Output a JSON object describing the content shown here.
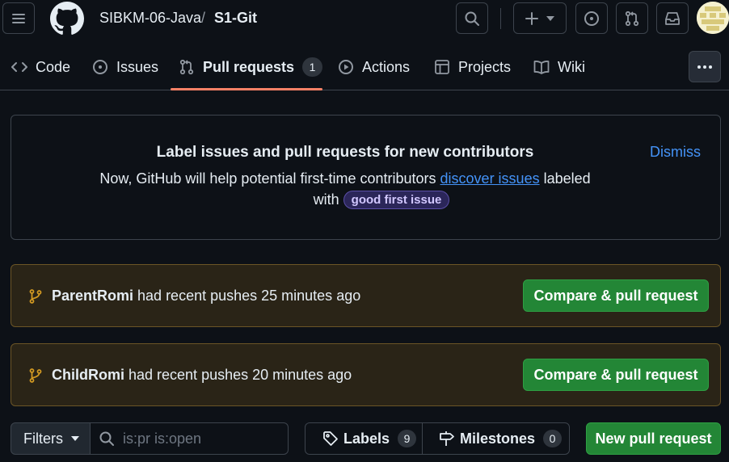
{
  "header": {
    "owner": "SIBKM-06-Java",
    "separator": "/",
    "repo": "S1-Git"
  },
  "nav": {
    "tabs": [
      {
        "label": "Code",
        "icon": "code-icon"
      },
      {
        "label": "Issues",
        "icon": "issue-opened-icon"
      },
      {
        "label": "Pull requests",
        "icon": "git-pull-request-icon",
        "count": "1",
        "active": true
      },
      {
        "label": "Actions",
        "icon": "play-icon"
      },
      {
        "label": "Projects",
        "icon": "table-icon"
      },
      {
        "label": "Wiki",
        "icon": "book-icon"
      }
    ]
  },
  "banner": {
    "title": "Label issues and pull requests for new contributors",
    "text_before_link": "Now, GitHub will help potential first-time contributors ",
    "link": "discover issues",
    "text_after_link": " labeled",
    "line2_prefix": "with ",
    "label": "good first issue",
    "dismiss": "Dismiss"
  },
  "pushes": [
    {
      "branch": "ParentRomi",
      "text": " had recent pushes 25 minutes ago",
      "button": "Compare & pull request"
    },
    {
      "branch": "ChildRomi",
      "text": " had recent pushes 20 minutes ago",
      "button": "Compare & pull request"
    }
  ],
  "toolbar": {
    "filters": "Filters",
    "search_value": "is:pr is:open",
    "labels": "Labels",
    "labels_count": "9",
    "milestones": "Milestones",
    "milestones_count": "0",
    "new_pr": "New pull request"
  },
  "colors": {
    "background": "#0d1117",
    "primary_button": "#238636",
    "active_tab_underline": "#f78166",
    "link": "#4493f8",
    "push_banner_bg": "#2a2417",
    "push_icon": "#d29922"
  }
}
